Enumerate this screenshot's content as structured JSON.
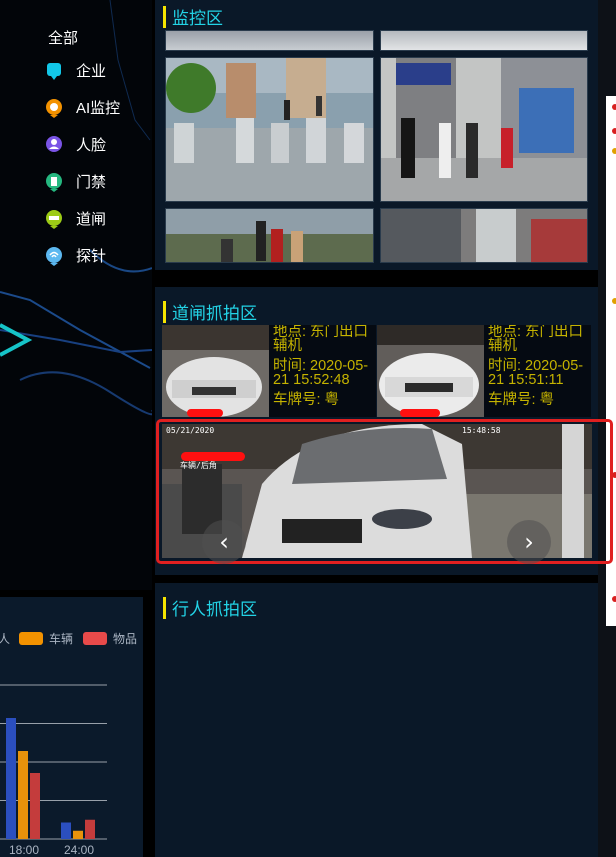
{
  "filters": {
    "all": "全部",
    "items": [
      {
        "label": "企业",
        "icon": "enterprise-icon",
        "color": "#12c7e8"
      },
      {
        "label": "AI监控",
        "icon": "ai-monitor-icon",
        "color": "#f39200"
      },
      {
        "label": "人脸",
        "icon": "face-icon",
        "color": "#7a54e6"
      },
      {
        "label": "门禁",
        "icon": "door-access-icon",
        "color": "#25b880"
      },
      {
        "label": "道闸",
        "icon": "barrier-gate-icon",
        "color": "#9ccb16"
      },
      {
        "label": "探针",
        "icon": "probe-icon",
        "color": "#5cb8f0"
      }
    ]
  },
  "monitor": {
    "title": "监控区"
  },
  "gate": {
    "title": "道闸抓拍区",
    "cards": [
      {
        "location": "地点: 东门出口辅机",
        "time": "时间: 2020-05-21 15:52:48",
        "plate": "车牌号: 粤"
      },
      {
        "location": "地点: 东门出口辅机",
        "time": "时间: 2020-05-21 15:51:11",
        "plate": "车牌号: 粤"
      }
    ],
    "photo_stamp_left": "05/21/2020",
    "photo_stamp_right": "15:48:58",
    "photo_tag": "车辆/后角",
    "prev": "‹",
    "next": "›"
  },
  "pedestrian": {
    "title": "行人抓拍区"
  },
  "chart_data": {
    "type": "bar",
    "legend": [
      "人",
      "车辆",
      "物品"
    ],
    "colors": [
      "#2b4fbf",
      "#e8920b",
      "#c43c3c"
    ],
    "categories": [
      "18:00",
      "24:00"
    ],
    "series": [
      {
        "name": "人",
        "values": [
          22,
          3
        ]
      },
      {
        "name": "车辆",
        "values": [
          16,
          1.5
        ]
      },
      {
        "name": "物品",
        "values": [
          12,
          3.5
        ]
      }
    ],
    "ylim": [
      0,
      28
    ]
  }
}
